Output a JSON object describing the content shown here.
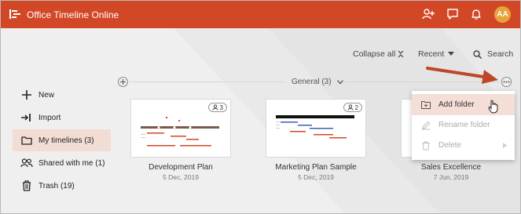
{
  "app": {
    "title": "Office Timeline Online"
  },
  "topbar": {
    "avatar_initials": "AA",
    "icons": [
      "add-user-icon",
      "comment-icon",
      "bell-icon"
    ]
  },
  "toolbar": {
    "collapse_label": "Collapse all",
    "sort_label": "Recent",
    "search_label": "Search"
  },
  "sidebar": {
    "items": [
      {
        "label": "New",
        "icon": "plus-icon"
      },
      {
        "label": "Import",
        "icon": "import-icon"
      },
      {
        "label": "My timelines (3)",
        "icon": "folder-icon",
        "active": true
      },
      {
        "label": "Shared with me (1)",
        "icon": "shared-users-icon"
      },
      {
        "label": "Trash (19)",
        "icon": "trash-icon"
      }
    ]
  },
  "group": {
    "label": "General (3)"
  },
  "cards": [
    {
      "title": "Development Plan",
      "date": "5 Dec, 2019",
      "shared_count": "3"
    },
    {
      "title": "Marketing Plan Sample",
      "date": "5 Dec, 2019",
      "shared_count": "2"
    },
    {
      "title": "Sales Excellence",
      "date": "7 Jun, 2019"
    }
  ],
  "menu": {
    "items": [
      {
        "label": "Add folder",
        "state": "hover"
      },
      {
        "label": "Rename folder",
        "state": "disabled"
      },
      {
        "label": "Delete",
        "state": "disabled"
      }
    ]
  },
  "colors": {
    "brand": "#d24726",
    "active_bg": "#f2ddd4",
    "avatar": "#e8a23a"
  }
}
